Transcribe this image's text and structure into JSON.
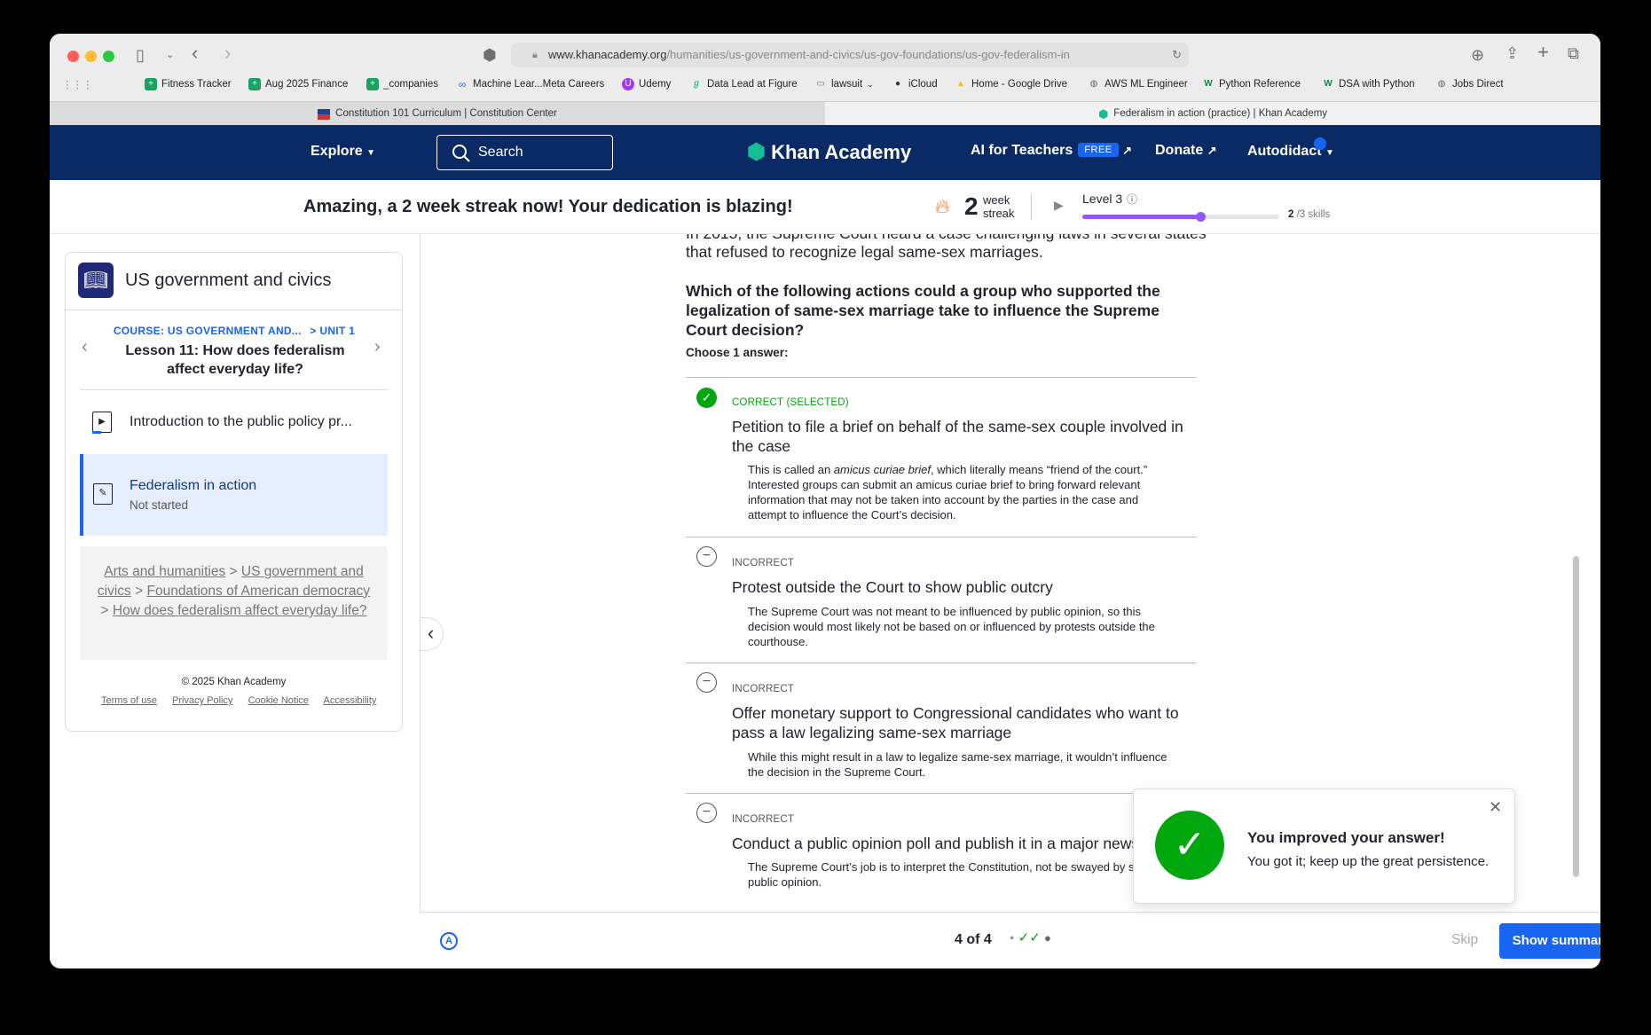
{
  "browser": {
    "url_main": "www.khanacademy.org",
    "url_path": "/humanities/us-government-and-civics/us-gov-foundations/us-gov-federalism-in",
    "bookmarks": [
      "Fitness Tracker",
      "Aug 2025 Finance",
      "_companies",
      "Machine Lear...Meta Careers",
      "Udemy",
      "Data Lead at Figure",
      "lawsuit",
      "iCloud",
      "Home - Google Drive",
      "AWS ML Engineer",
      "Python Reference",
      "DSA with Python",
      "Jobs Direct"
    ],
    "tabs": [
      "Constitution 101 Curriculum | Constitution Center",
      "Federalism in action (practice) | Khan Academy"
    ]
  },
  "nav": {
    "explore": "Explore",
    "search": "Search",
    "brand": "Khan Academy",
    "ai_teachers": "AI for Teachers",
    "free_badge": "FREE",
    "donate": "Donate",
    "user": "Autodidact"
  },
  "streak": {
    "message": "Amazing, a 2 week streak now! Your dedication is blazing!",
    "count": "2",
    "unit_line1": "week",
    "unit_line2": "streak",
    "level": "Level 3",
    "skills_done": "2",
    "skills_total": "/3 skills",
    "progress_fraction": 0.6
  },
  "sidebar": {
    "course_title": "US government and civics",
    "breadcrumb_course": "COURSE: US GOVERNMENT AND...",
    "breadcrumb_unit": "> UNIT 1",
    "lesson_title": "Lesson 11: How does federalism affect everyday life?",
    "items": [
      {
        "label": "Introduction to the public policy pr..."
      },
      {
        "label": "Federalism in action",
        "status": "Not started"
      }
    ],
    "crumbs": {
      "a": "Arts and humanities",
      "b": "US government and civics",
      "c": "Foundations of American democracy",
      "d": "How does federalism affect everyday life?"
    },
    "copyright": "© 2025 Khan Academy",
    "links": [
      "Terms of use",
      "Privacy Policy",
      "Cookie Notice",
      "Accessibility"
    ]
  },
  "question": {
    "context_partial": "In 2015, the Supreme Court heard a case challenging laws in several states",
    "context_end": "that refused to recognize legal same-sex marriages.",
    "prompt": "Which of the following actions could a group who supported the legalization of same-sex marriage take to influence the Supreme Court decision?",
    "choose": "Choose 1 answer:",
    "options": [
      {
        "status": "CORRECT (SELECTED)",
        "text": "Petition to file a brief on behalf of the same-sex couple involved in the case",
        "exp_pre": "This is called an ",
        "exp_em": "amicus curiae brief",
        "exp_post": ", which literally means “friend of the court.” Interested groups can submit an amicus curiae brief to bring forward relevant information that may not be taken into account by the parties in the case and attempt to influence the Court’s decision."
      },
      {
        "status": "INCORRECT",
        "text": "Protest outside the Court to show public outcry",
        "explanation": "The Supreme Court was not meant to be influenced by public opinion, so this decision would most likely not be based on or influenced by protests outside the courthouse."
      },
      {
        "status": "INCORRECT",
        "text": "Offer monetary support to Congressional candidates who want to pass a law legalizing same-sex marriage",
        "explanation": "While this might result in a law to legalize same-sex marriage, it wouldn’t influence the decision in the Supreme Court."
      },
      {
        "status": "INCORRECT",
        "text": "Conduct a public opinion poll and publish it in a major newspaper",
        "explanation": "The Supreme Court’s job is to interpret the Constitution, not be swayed by shifts of public opinion."
      }
    ]
  },
  "footer": {
    "counter": "4 of 4",
    "skip": "Skip",
    "summary": "Show summary"
  },
  "toast": {
    "title": "You improved your answer!",
    "body": "You got it; keep up the great persistence."
  },
  "colors": {
    "nav_bg": "#0a2a66",
    "accent": "#1865f2",
    "correct": "#00a60e",
    "progress": "#9059ff"
  }
}
